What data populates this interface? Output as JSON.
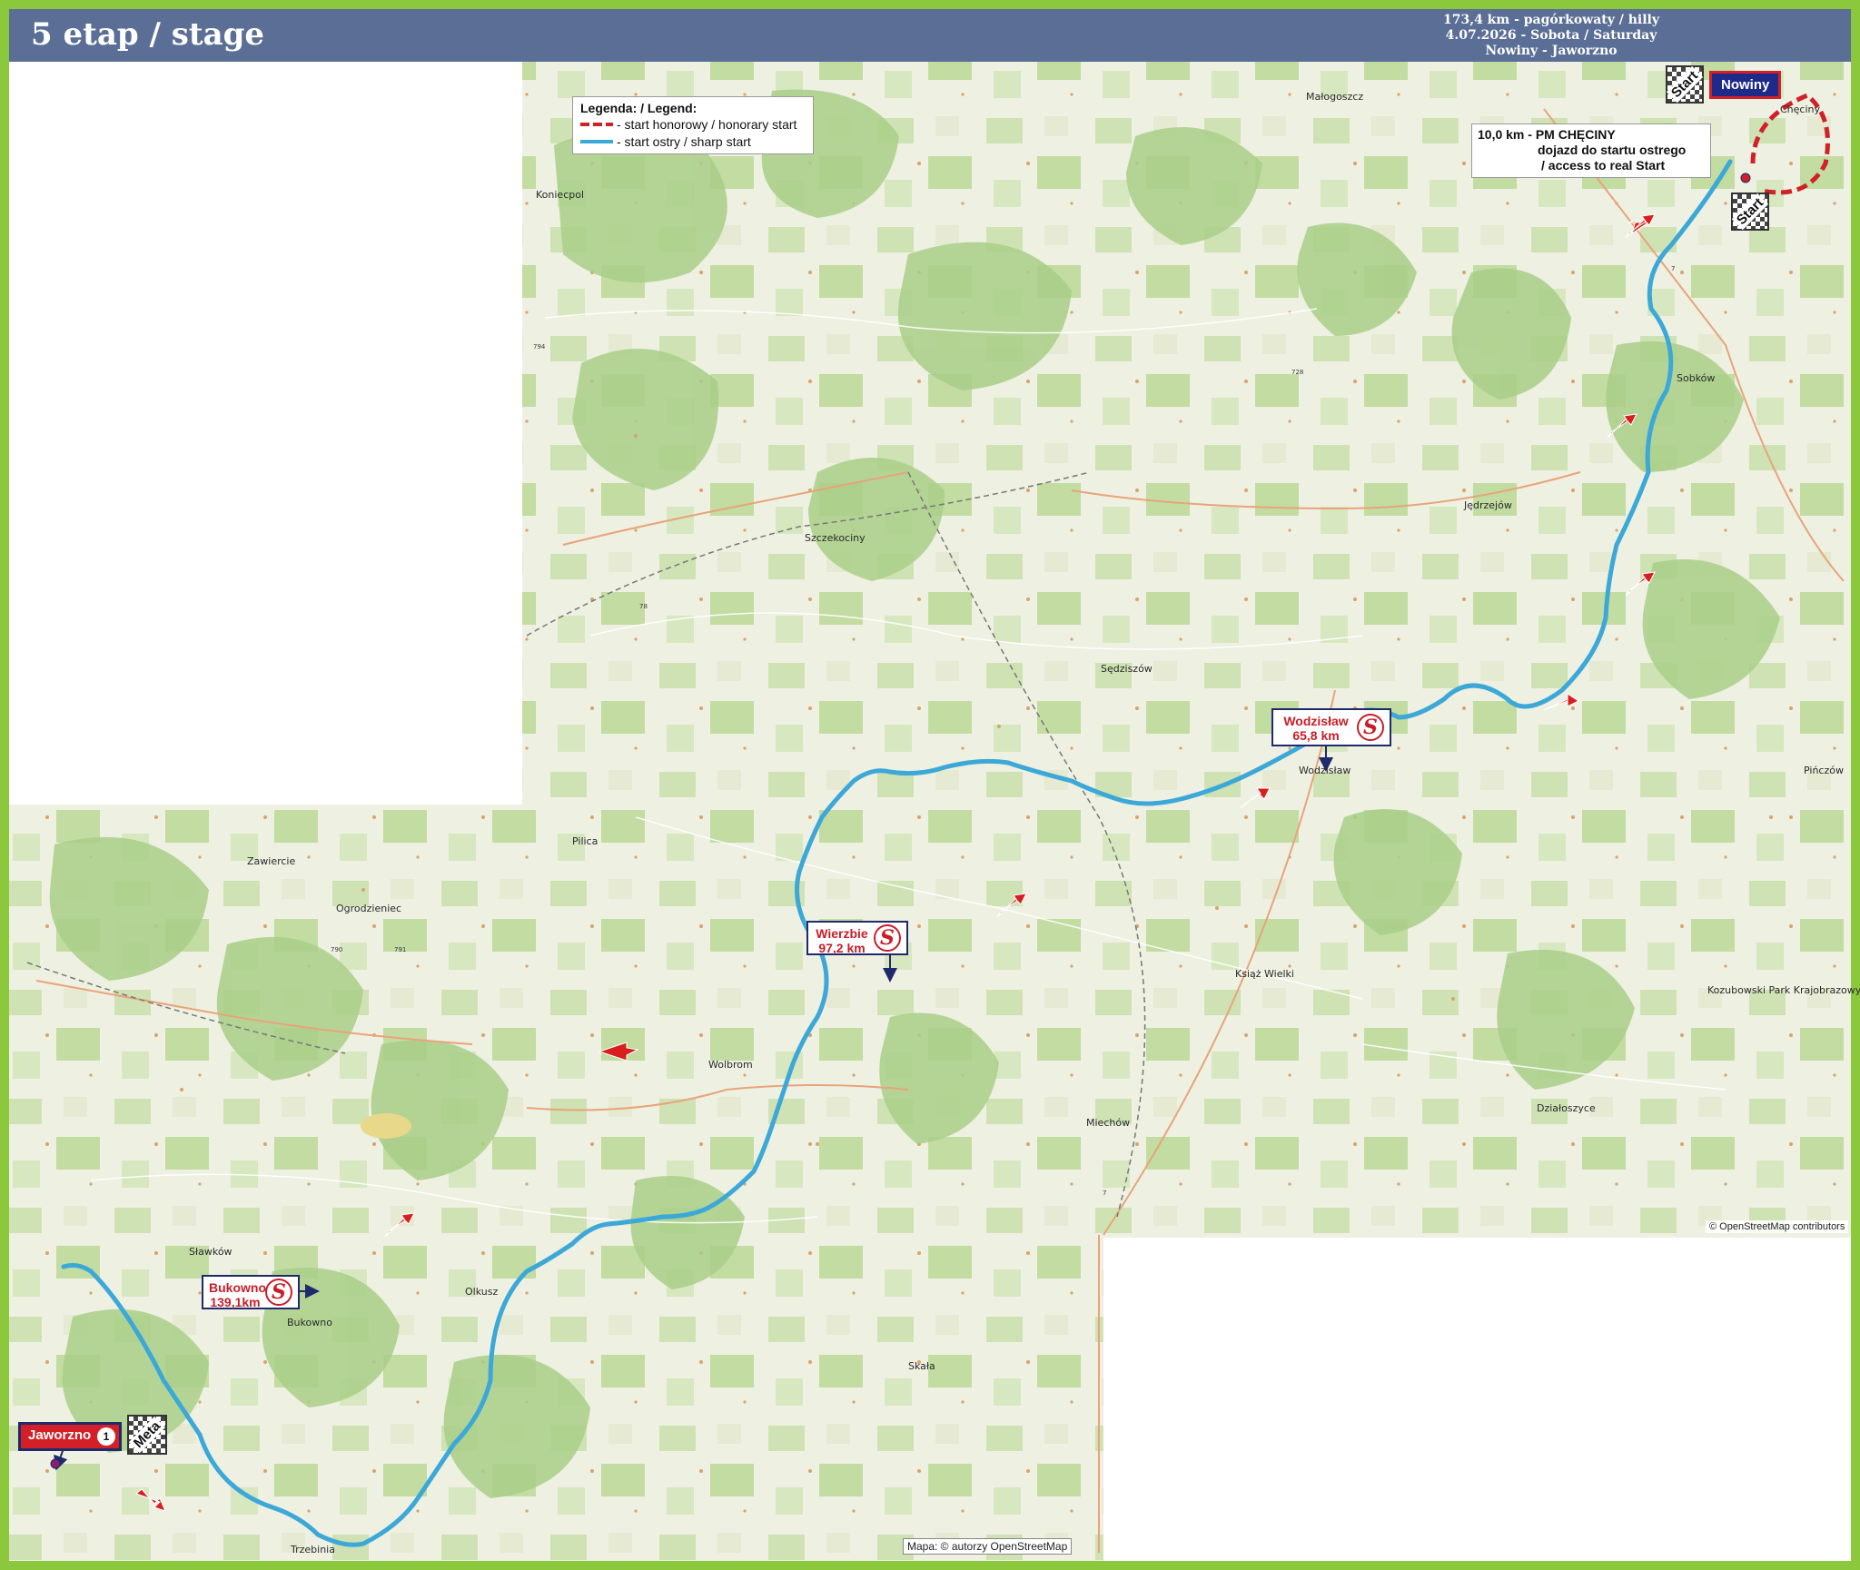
{
  "header": {
    "title": "5 etap / stage",
    "distance_profile": "173,4 km - pagórkowaty / hilly",
    "date": "4.07.2026 -  Sobota / Saturday",
    "route": "Nowiny - Jaworzno"
  },
  "legend": {
    "title": "Legenda: / Legend:",
    "honorary": "- start honorowy / honorary start",
    "sharp": "- start ostry / sharp start"
  },
  "start_info": {
    "line1": "10,0 km -  PM CHĘCINY",
    "line2": "dojazd do startu ostrego",
    "line3": "/ access to real Start"
  },
  "start_town": "Nowiny",
  "start_flags": [
    "Start",
    "Start"
  ],
  "finish_town": "Jaworzno",
  "finish_flag": "Meta",
  "finish_badge": "1",
  "sprints": [
    {
      "name": "Wodzisław",
      "km": "65,8 km",
      "symbol": "S"
    },
    {
      "name": "Wierzbie",
      "km": "97,2 km",
      "symbol": "S"
    },
    {
      "name": "Bukowno",
      "km": "139,1km",
      "symbol": "S"
    }
  ],
  "credits": {
    "osm_top": "© OpenStreetMap contributors",
    "osm_bottom": "Mapa: © autorzy OpenStreetMap"
  },
  "map_labels": {
    "towns": [
      "Jędrzejów",
      "Sędziszów",
      "Wolbrom",
      "Olkusz",
      "Szczekociny",
      "Pilica",
      "Ogrodzieniec",
      "Zawiercie",
      "Sławków",
      "Bukowno",
      "Działoszyce",
      "Książ Wielki",
      "Skała",
      "Miechów",
      "Koniecpol",
      "Małogoszcz",
      "Sobków",
      "Pińczów",
      "Trzebinia",
      "Wodzisław",
      "Chęciny"
    ],
    "roads": [
      "78",
      "794",
      "790",
      "791",
      "7",
      "728",
      "7"
    ],
    "park_names": [
      "Kozubowski Park Krajobrazowy"
    ]
  },
  "colors": {
    "frame": "#8cc83c",
    "header": "#5a6e96",
    "route_sharp": "#3ca8d8",
    "route_honorary": "#d02028",
    "arrow": "#d81e1e"
  }
}
